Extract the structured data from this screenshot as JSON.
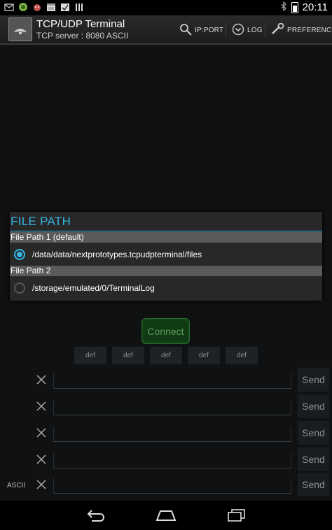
{
  "status_bar": {
    "time": "20:11",
    "icons": [
      "gmail-icon",
      "android-icon",
      "cat-icon",
      "calendar-icon",
      "checklist-icon",
      "bars-icon"
    ],
    "right_icons": [
      "bluetooth-icon",
      "battery-icon"
    ]
  },
  "action_bar": {
    "title": "TCP/UDP Terminal",
    "subtitle": "TCP server : 8080  ASCII",
    "ipport_label": "IP:PORT",
    "log_label": "LOG",
    "preference_label": "PREFERENCE"
  },
  "dialog": {
    "title": "FILE PATH",
    "sections": [
      {
        "header": "File Path 1 (default)",
        "option": "/data/data/nextprototypes.tcpudpterminal/files",
        "selected": true
      },
      {
        "header": "File Path 2",
        "option": "/storage/emulated/0/TerminalLog",
        "selected": false
      }
    ]
  },
  "connect_label": "Connect",
  "macros": [
    "def",
    "def",
    "def",
    "def",
    "def"
  ],
  "send_rows": [
    {
      "send_label": "Send",
      "value": ""
    },
    {
      "send_label": "Send",
      "value": ""
    },
    {
      "send_label": "Send",
      "value": ""
    },
    {
      "send_label": "Send",
      "value": ""
    },
    {
      "send_label": "Send",
      "value": ""
    }
  ],
  "mode_label": "ASCII",
  "colors": {
    "accent": "#33b5e5",
    "connect_green": "#5d9c5f",
    "dialog_bg": "#282828"
  }
}
